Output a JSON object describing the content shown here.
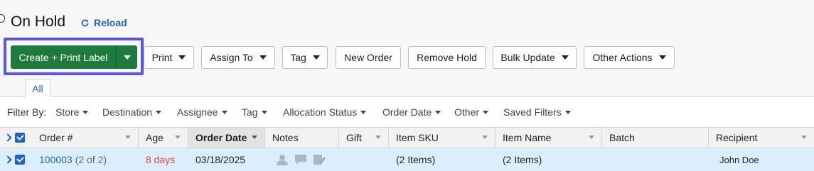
{
  "header": {
    "title": "On Hold",
    "reload_label": "Reload"
  },
  "toolbar": {
    "primary_label": "Create + Print Label",
    "print_label": "Print",
    "assign_label": "Assign To",
    "tag_label": "Tag",
    "new_order_label": "New Order",
    "remove_hold_label": "Remove Hold",
    "bulk_update_label": "Bulk Update",
    "other_actions_label": "Other Actions"
  },
  "tabs": {
    "all_label": "All"
  },
  "filters": {
    "label": "Filter By:",
    "items": [
      "Store",
      "Destination",
      "Assignee",
      "Tag",
      "Allocation Status",
      "Order Date",
      "Other",
      "Saved Filters"
    ]
  },
  "table": {
    "columns": [
      "Order #",
      "Age",
      "Order Date",
      "Notes",
      "Gift",
      "Item SKU",
      "Item Name",
      "Batch",
      "Recipient"
    ],
    "sorted_column": "Order Date",
    "rows": [
      {
        "order_number": "100003",
        "order_count": "(2 of 2)",
        "age": "8 days",
        "order_date": "03/18/2025",
        "gift": "",
        "item_sku": "(2 Items)",
        "item_name": "(2 Items)",
        "batch": "",
        "recipient": "John Doe"
      }
    ]
  },
  "colors": {
    "primary_green": "#1e7a3c",
    "link_blue": "#1a63c8",
    "highlight": "#5b52f0",
    "age_red": "#e0463a",
    "selected_row": "#dbeefb"
  },
  "icons": [
    "reload-icon",
    "chevron-right-icon",
    "checkbox-checked-icon",
    "person-icon",
    "comment-icon",
    "edit-note-icon"
  ]
}
